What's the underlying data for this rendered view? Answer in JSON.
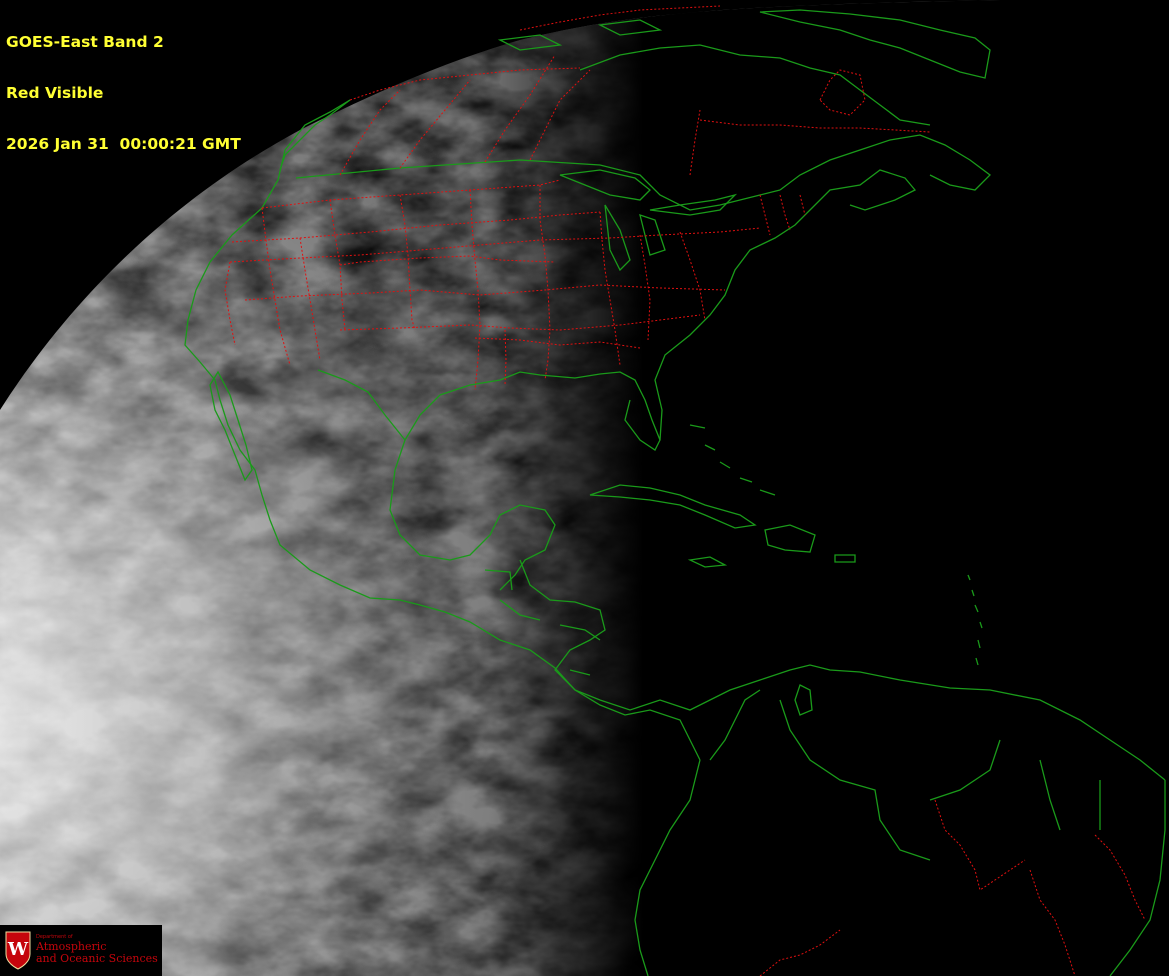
{
  "caption": {
    "line1": "GOES-East Band 2",
    "line2": "Red Visible",
    "line3": "2026 Jan 31  00:00:21 GMT"
  },
  "colors": {
    "caption_text": "#ffff33",
    "coastline": "#1a9a1a",
    "state_borders": "#e01010",
    "logo_red": "#c5050c",
    "space": "#000000"
  },
  "logo": {
    "shield_letter": "W",
    "department_line": "Department of",
    "line1": "Atmospheric",
    "line2": "and Oceanic Sciences"
  }
}
